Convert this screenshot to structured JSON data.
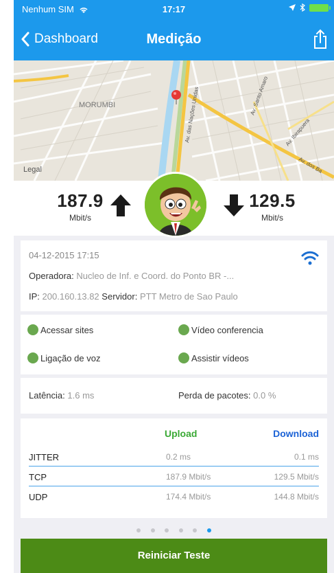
{
  "status": {
    "carrier": "Nenhum SIM",
    "time": "17:17"
  },
  "nav": {
    "back_label": "Dashboard",
    "title": "Medição"
  },
  "map": {
    "labels": [
      "Morumbi",
      "Legal",
      "Av. das Nações Unidas",
      "Av. Santo Amaro",
      "Av. Ibirapuera",
      "Av. dos Ba"
    ],
    "area_label": "MORUMBI",
    "legal": "Legal"
  },
  "speed": {
    "upload_value": "187.9",
    "upload_unit": "Mbit/s",
    "download_value": "129.5",
    "download_unit": "Mbit/s"
  },
  "info": {
    "date": "04-12-2015 17:15",
    "operator_label": "Operadora:",
    "operator_value": "Nucleo de Inf. e Coord. do Ponto BR -...",
    "ip_label": "IP:",
    "ip_value": "200.160.13.82",
    "server_label": "Servidor:",
    "server_value": "PTT Metro de Sao Paulo"
  },
  "quality": {
    "sites": "Acessar sites",
    "video_conf": "Vídeo conferencia",
    "voice": "Ligação de voz",
    "watch": "Assistir vídeos"
  },
  "latency": {
    "latency_label": "Latência:",
    "latency_value": "1.6 ms",
    "loss_label": "Perda de pacotes:",
    "loss_value": "0.0 %"
  },
  "table": {
    "upload_header": "Upload",
    "download_header": "Download",
    "rows": [
      {
        "name": "JITTER",
        "up": "0.2 ms",
        "down": "0.1 ms"
      },
      {
        "name": "TCP",
        "up": "187.9 Mbit/s",
        "down": "129.5 Mbit/s"
      },
      {
        "name": "UDP",
        "up": "174.4 Mbit/s",
        "down": "144.8 Mbit/s"
      }
    ]
  },
  "pager": {
    "total": 6,
    "active": 6
  },
  "restart_label": "Reiniciar Teste",
  "colors": {
    "accent": "#1c99ec",
    "upload": "#3aa935",
    "download": "#1c63d6",
    "button": "#4c8b16"
  }
}
